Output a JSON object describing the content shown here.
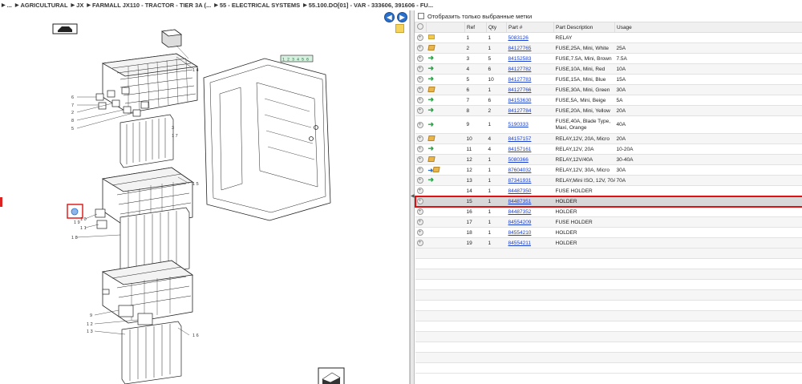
{
  "breadcrumb": {
    "items": [
      "...",
      "AGRICULTURAL",
      "JX",
      "FARMALL JX110 - TRACTOR - TIER 3A (...",
      "55 - ELECTRICAL SYSTEMS",
      "55.100.DO[01] - VAR - 333606, 391606 - FU..."
    ]
  },
  "left": {
    "prev_label": "◀",
    "next_label": "▶",
    "callouts": {
      "c14": "1 4",
      "c6": "6",
      "c7": "7",
      "c2": "2",
      "c8": "8",
      "c5": "5",
      "c3": "3",
      "c17": "1 7",
      "c15": "1 5",
      "c10": "1 0",
      "c11": "1 1",
      "c19": "1 9",
      "c18": "1 8",
      "c9": "9",
      "c12": "1 2",
      "c13": "1 3",
      "c16": "1 6"
    },
    "panel_label": "1 2 3 4 5 6"
  },
  "right": {
    "filter_label": "Отобразить только выбранные метки",
    "columns": [
      "Ref",
      "Qty",
      "Part #",
      "Part Description",
      "Usage"
    ],
    "rows": [
      {
        "icon": "folder-icon",
        "ref": "1",
        "qty": "1",
        "part": "5083126",
        "desc": "RELAY",
        "usage": ""
      },
      {
        "icon": "box-icon",
        "ref": "2",
        "qty": "1",
        "part": "84127765",
        "desc": "FUSE,25A, Mini, White",
        "usage": "25A"
      },
      {
        "icon": "arrow-icon",
        "ref": "3",
        "qty": "5",
        "part": "84152583",
        "desc": "FUSE,7.5A, Mini, Brown",
        "usage": "7.5A"
      },
      {
        "icon": "arrow-icon",
        "ref": "4",
        "qty": "6",
        "part": "84127782",
        "desc": "FUSE,10A, Mini, Red",
        "usage": "10A"
      },
      {
        "icon": "arrow-icon",
        "ref": "5",
        "qty": "10",
        "part": "84127783",
        "desc": "FUSE,15A, Mini, Blue",
        "usage": "15A"
      },
      {
        "icon": "box-icon",
        "ref": "6",
        "qty": "1",
        "part": "84127766",
        "desc": "FUSE,30A, Mini, Green",
        "usage": "30A"
      },
      {
        "icon": "arrow-icon",
        "ref": "7",
        "qty": "6",
        "part": "84153630",
        "desc": "FUSE,5A, Mini, Beige",
        "usage": "5A"
      },
      {
        "icon": "arrow-icon",
        "ref": "8",
        "qty": "2",
        "part": "84127784",
        "desc": "FUSE,20A, Mini, Yellow",
        "usage": "20A"
      },
      {
        "icon": "arrow-icon",
        "ref": "9",
        "qty": "1",
        "part": "5190333",
        "desc": "FUSE,40A, Blade Type, Maxi, Orange",
        "usage": "40A"
      },
      {
        "icon": "box-icon",
        "ref": "10",
        "qty": "4",
        "part": "84157157",
        "desc": "RELAY,12V, 20A, Micro",
        "usage": "20A"
      },
      {
        "icon": "arrow-icon",
        "ref": "11",
        "qty": "4",
        "part": "84157161",
        "desc": "RELAY,12V, 20A",
        "usage": "10-20A"
      },
      {
        "icon": "box-icon",
        "ref": "12",
        "qty": "1",
        "part": "5080366",
        "desc": "RELAY,12V/40A",
        "usage": "30-40A"
      },
      {
        "icon": "arrow-box-icon",
        "ref": "12",
        "qty": "1",
        "part": "87604032",
        "desc": "RELAY,12V, 30A, Micro",
        "usage": "30A"
      },
      {
        "icon": "arrow-icon",
        "ref": "13",
        "qty": "1",
        "part": "87341931",
        "desc": "RELAY,Mini ISO, 12V, 70A",
        "usage": "70A"
      },
      {
        "icon": "",
        "ref": "14",
        "qty": "1",
        "part": "84487350",
        "desc": "FUSE HOLDER",
        "usage": ""
      },
      {
        "icon": "",
        "ref": "15",
        "qty": "1",
        "part": "84487351",
        "desc": "HOLDER",
        "usage": "",
        "selected": true
      },
      {
        "icon": "",
        "ref": "16",
        "qty": "1",
        "part": "84487352",
        "desc": "HOLDER",
        "usage": ""
      },
      {
        "icon": "",
        "ref": "17",
        "qty": "1",
        "part": "84554209",
        "desc": "FUSE HOLDER",
        "usage": ""
      },
      {
        "icon": "",
        "ref": "18",
        "qty": "1",
        "part": "84554210",
        "desc": "HOLDER",
        "usage": ""
      },
      {
        "icon": "",
        "ref": "19",
        "qty": "1",
        "part": "84554211",
        "desc": "HOLDER",
        "usage": ""
      }
    ]
  },
  "colors": {
    "accent": "#2a6fc9",
    "link": "#1a3fd1",
    "highlight": "#dd1111"
  }
}
